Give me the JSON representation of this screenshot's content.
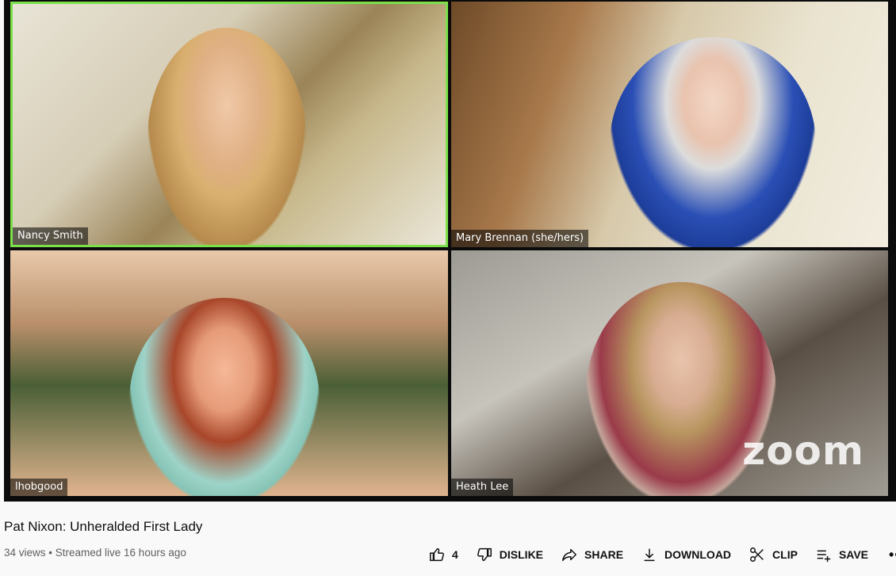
{
  "participants": [
    {
      "name": "Nancy Smith",
      "active": true
    },
    {
      "name": "Mary Brennan (she/hers)",
      "active": false
    },
    {
      "name": "lhobgood",
      "active": false
    },
    {
      "name": "Heath Lee",
      "active": false
    }
  ],
  "watermark": "zoom",
  "video": {
    "title": "Pat Nixon: Unheralded First Lady",
    "meta": "34 views • Streamed live 16 hours ago"
  },
  "actions": {
    "like_count": "4",
    "dislike": "DISLIKE",
    "share": "SHARE",
    "download": "DOWNLOAD",
    "clip": "CLIP",
    "save": "SAVE",
    "more": "•••"
  },
  "colors": {
    "active_speaker_border": "#7be04a",
    "meta_text": "#606060"
  }
}
